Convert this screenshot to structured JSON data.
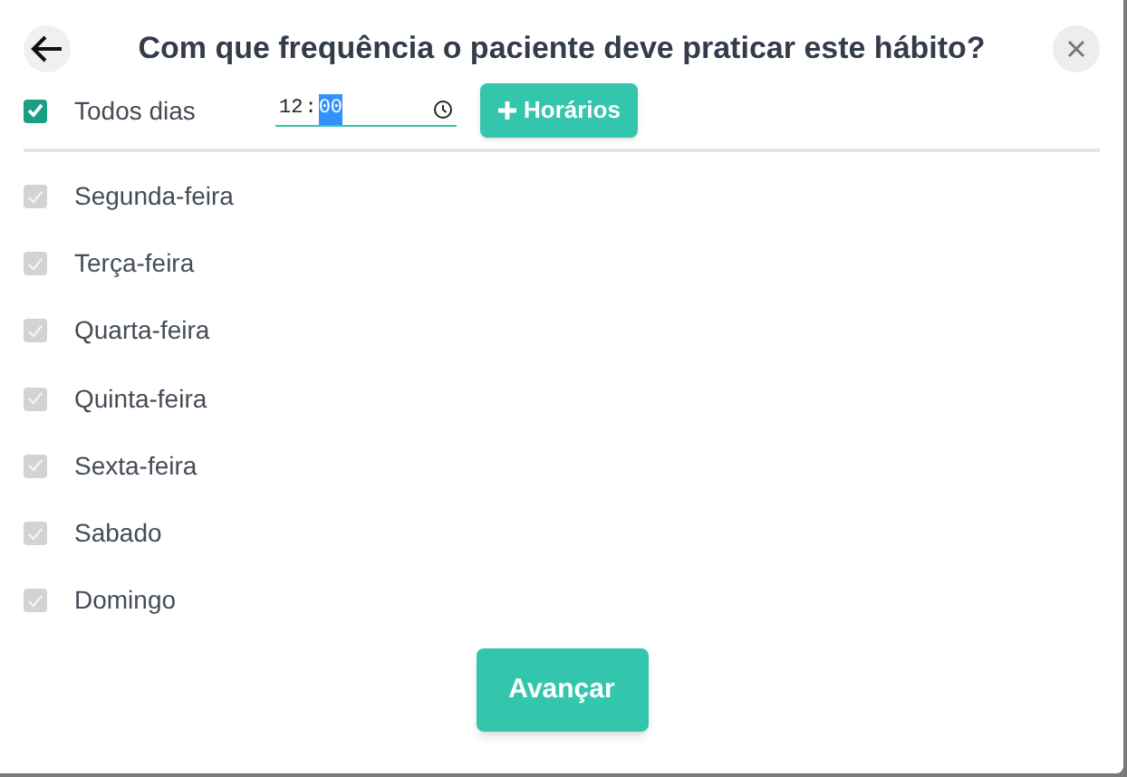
{
  "title": "Com que frequência o paciente deve praticar este hábito?",
  "all_days": {
    "label": "Todos dias",
    "checked": true
  },
  "time": {
    "hour": "12",
    "separator": ":",
    "minute": "00",
    "minute_selected": true
  },
  "add_times_button": "Horários",
  "days": [
    {
      "label": "Segunda-feira",
      "checked": true,
      "disabled": true
    },
    {
      "label": "Terça-feira",
      "checked": true,
      "disabled": true
    },
    {
      "label": "Quarta-feira",
      "checked": true,
      "disabled": true
    },
    {
      "label": "Quinta-feira",
      "checked": true,
      "disabled": true
    },
    {
      "label": "Sexta-feira",
      "checked": true,
      "disabled": true
    },
    {
      "label": "Sabado",
      "checked": true,
      "disabled": true
    },
    {
      "label": "Domingo",
      "checked": true,
      "disabled": true
    }
  ],
  "next_button": "Avançar"
}
